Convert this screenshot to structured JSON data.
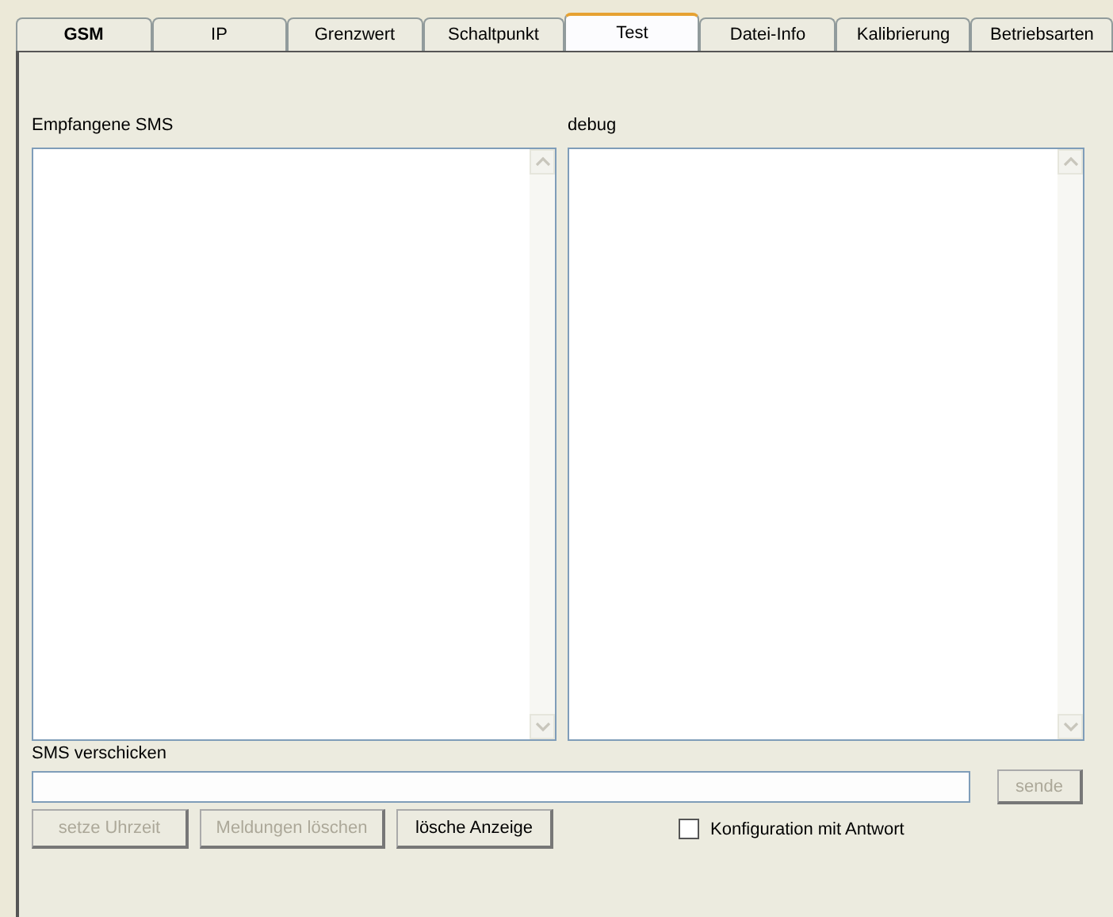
{
  "tabs": [
    {
      "label": "GSM",
      "selected": false,
      "bold": true
    },
    {
      "label": "IP",
      "selected": false,
      "bold": false
    },
    {
      "label": "Grenzwert",
      "selected": false,
      "bold": false
    },
    {
      "label": "Schaltpunkt",
      "selected": false,
      "bold": false
    },
    {
      "label": "Test",
      "selected": true,
      "bold": false
    },
    {
      "label": "Datei-Info",
      "selected": false,
      "bold": false
    },
    {
      "label": "Kalibrierung",
      "selected": false,
      "bold": false
    },
    {
      "label": "Betriebsarten",
      "selected": false,
      "bold": false
    }
  ],
  "panes": [
    {
      "label": "Empfangene SMS"
    },
    {
      "label": "debug"
    }
  ],
  "send": {
    "label": "SMS verschicken",
    "button": {
      "label": "sende",
      "disabled": true
    }
  },
  "buttons": [
    {
      "label": "setze Uhrzeit",
      "disabled": true
    },
    {
      "label": "Meldungen löschen",
      "disabled": true
    },
    {
      "label": "lösche Anzeige",
      "disabled": false
    }
  ],
  "checkbox": {
    "label": "Konfiguration mit Antwort",
    "checked": false
  }
}
